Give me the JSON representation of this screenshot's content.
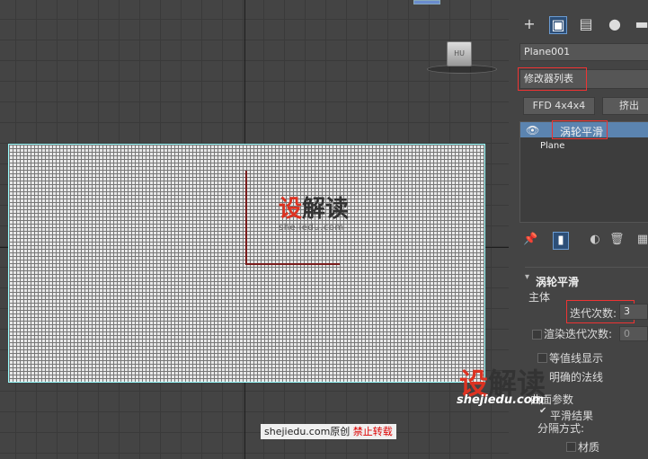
{
  "panel": {
    "object_name": "Plane001",
    "modifier_list": "修改器列表",
    "btn_ffd": "FFD 4x4x4",
    "btn_extrude": "挤出",
    "stack": [
      "涡轮平滑",
      "Plane"
    ],
    "rollout_title": "涡轮平滑",
    "main_group": "主体",
    "iterations_label": "迭代次数:",
    "iterations_value": "3",
    "render_iters_label": "渲染迭代次数:",
    "render_iters_value": "0",
    "isoline_label": "等值线显示",
    "explicit_normals_label": "明确的法线",
    "surface_group": "曲面参数",
    "smooth_result_label": "平滑结果",
    "separate_by_label": "分隔方式:",
    "material_label": "材质",
    "icons": [
      "plus-icon",
      "modify-icon",
      "hierarchy-icon",
      "motion-icon",
      "display-icon",
      "pin-icon",
      "show-end-icon",
      "make-unique-icon",
      "trash-icon",
      "configure-icon",
      "eye-icon"
    ]
  },
  "watermarks": {
    "main_red": "设",
    "main_black": "解读",
    "main_sub": "shejiedu.com",
    "corner_red": "设",
    "corner_black": "解读",
    "corner_sub": "shejiedu.com"
  },
  "footer": {
    "site": "shejiedu.com",
    "original": "原创",
    "warning": "禁止转载"
  },
  "viewcube_label": "HU",
  "colors": {
    "selection_outline": "#99ffff",
    "red_highlight": "#ee3333",
    "modify_tab_bg": "#2d4f78",
    "stack_selected": "#5b84b0"
  }
}
